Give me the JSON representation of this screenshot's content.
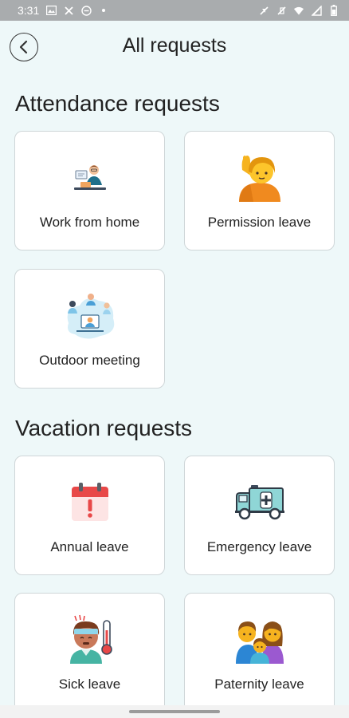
{
  "status_bar": {
    "time": "3:31",
    "icons_left": [
      "gallery-icon",
      "missed-call-icon",
      "do-not-disturb-icon",
      "dot-icon"
    ],
    "icons_right": [
      "mute-icon",
      "vibrate-icon",
      "wifi-icon",
      "signal-icon",
      "battery-icon"
    ]
  },
  "header": {
    "title": "All requests",
    "back_icon": "chevron-left-icon"
  },
  "sections": {
    "attendance": {
      "title": "Attendance requests",
      "cards": [
        {
          "label": "Work from home",
          "icon": "work-from-home-icon"
        },
        {
          "label": "Permission leave",
          "icon": "raising-hand-icon"
        },
        {
          "label": "Outdoor meeting",
          "icon": "outdoor-meeting-icon"
        }
      ]
    },
    "vacation": {
      "title": "Vacation requests",
      "cards": [
        {
          "label": "Annual leave",
          "icon": "calendar-alert-icon"
        },
        {
          "label": "Emergency leave",
          "icon": "ambulance-icon"
        },
        {
          "label": "Sick leave",
          "icon": "sick-person-icon"
        },
        {
          "label": "Paternity leave",
          "icon": "family-icon"
        }
      ]
    }
  },
  "colors": {
    "background": "#eef8f9",
    "card_background": "#ffffff",
    "card_border": "#cfd6d8",
    "status_bar": "#a9acae"
  }
}
